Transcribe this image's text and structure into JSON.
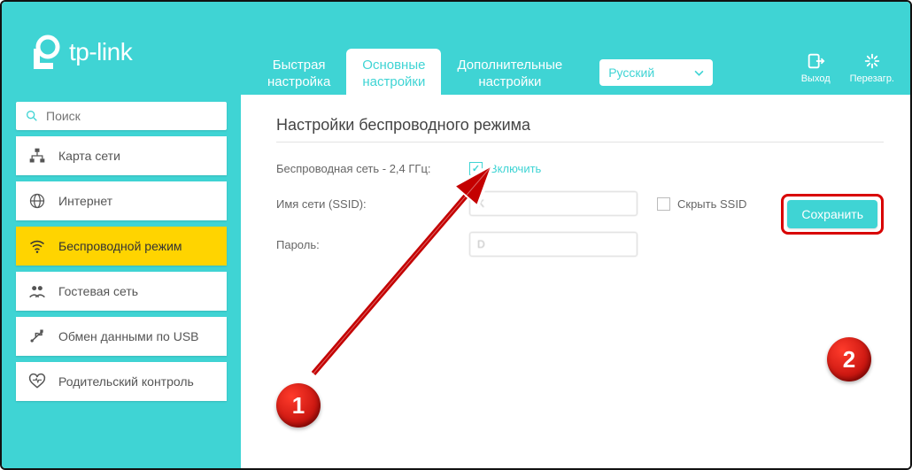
{
  "brand": "tp-link",
  "header": {
    "tabs": [
      {
        "line1": "Быстрая",
        "line2": "настройка"
      },
      {
        "line1": "Основные",
        "line2": "настройки"
      },
      {
        "line1": "Дополнительные",
        "line2": "настройки"
      }
    ],
    "active_tab_index": 1,
    "language": "Русский",
    "logout_label": "Выход",
    "reboot_label": "Перезагр."
  },
  "sidebar": {
    "search_placeholder": "Поиск",
    "items": [
      {
        "label": "Карта сети",
        "icon": "network-map"
      },
      {
        "label": "Интернет",
        "icon": "globe"
      },
      {
        "label": "Беспроводной режим",
        "icon": "wifi",
        "active": true
      },
      {
        "label": "Гостевая сеть",
        "icon": "guests"
      },
      {
        "label": "Обмен данными по USB",
        "icon": "usb"
      },
      {
        "label": "Родительский контроль",
        "icon": "heart"
      }
    ]
  },
  "main": {
    "title": "Настройки беспроводного режима",
    "wireless_24_label": "Беспроводная сеть - 2,4 ГГц:",
    "enable_label": "Включить",
    "enable_checked": true,
    "ssid_label": "Имя сети (SSID):",
    "ssid_value": "K",
    "hide_ssid_label": "Скрыть SSID",
    "hide_ssid_checked": false,
    "password_label": "Пароль:",
    "password_value": "D",
    "save_label": "Сохранить"
  },
  "annotations": {
    "badge1": "1",
    "badge2": "2"
  }
}
